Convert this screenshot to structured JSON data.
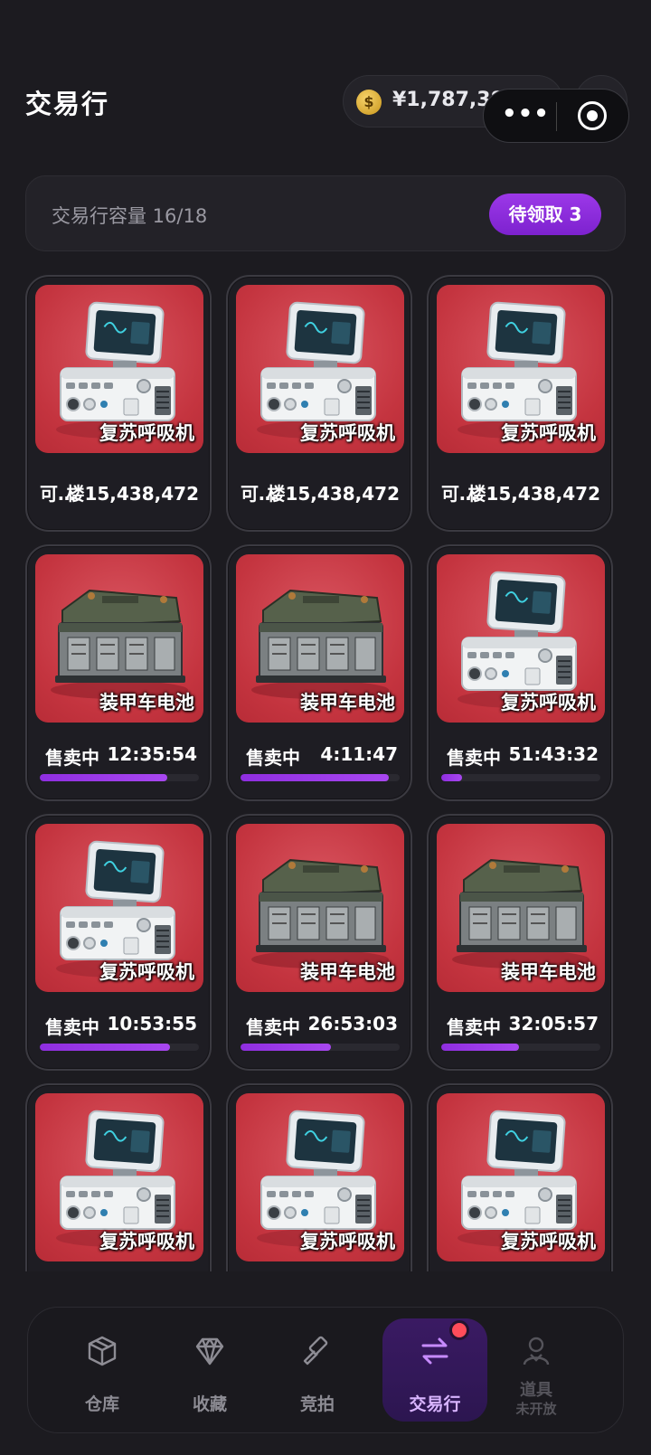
{
  "header": {
    "title": "交易行",
    "coin_symbol": "$",
    "balance": "¥1,787,382,693",
    "plus_label": "+"
  },
  "capacity": {
    "label": "交易行容量 16/18",
    "pending_button": "待领取 3"
  },
  "cards": [
    {
      "item": "复苏呼吸机",
      "icon": "ventilator",
      "mode": "price",
      "price_prefix": "可…",
      "price": "楼15,438,472"
    },
    {
      "item": "复苏呼吸机",
      "icon": "ventilator",
      "mode": "price",
      "price_prefix": "可…",
      "price": "楼15,438,472"
    },
    {
      "item": "复苏呼吸机",
      "icon": "ventilator",
      "mode": "price",
      "price_prefix": "可…",
      "price": "楼15,438,472"
    },
    {
      "item": "装甲车电池",
      "icon": "battery",
      "mode": "selling",
      "status": "售卖中",
      "time": "12:35:54",
      "progress": 0.8
    },
    {
      "item": "装甲车电池",
      "icon": "battery",
      "mode": "selling",
      "status": "售卖中",
      "time": "4:11:47",
      "progress": 0.93
    },
    {
      "item": "复苏呼吸机",
      "icon": "ventilator",
      "mode": "selling",
      "status": "售卖中",
      "time": "51:43:32",
      "progress": 0.13
    },
    {
      "item": "复苏呼吸机",
      "icon": "ventilator",
      "mode": "selling",
      "status": "售卖中",
      "time": "10:53:55",
      "progress": 0.82
    },
    {
      "item": "装甲车电池",
      "icon": "battery",
      "mode": "selling",
      "status": "售卖中",
      "time": "26:53:03",
      "progress": 0.57
    },
    {
      "item": "装甲车电池",
      "icon": "battery",
      "mode": "selling",
      "status": "售卖中",
      "time": "32:05:57",
      "progress": 0.49
    },
    {
      "item": "复苏呼吸机",
      "icon": "ventilator",
      "mode": "selling",
      "status": "",
      "time": "",
      "progress": 0
    },
    {
      "item": "复苏呼吸机",
      "icon": "ventilator",
      "mode": "selling",
      "status": "",
      "time": "",
      "progress": 0
    },
    {
      "item": "复苏呼吸机",
      "icon": "ventilator",
      "mode": "selling",
      "status": "",
      "time": "",
      "progress": 0
    }
  ],
  "tabs": [
    {
      "label": "仓库",
      "icon": "box-icon"
    },
    {
      "label": "收藏",
      "icon": "diamond-icon"
    },
    {
      "label": "竞拍",
      "icon": "gavel-icon"
    },
    {
      "label": "交易行",
      "icon": "swap-icon"
    },
    {
      "label": "道具",
      "sublabel": "未开放",
      "icon": "person-icon"
    }
  ],
  "colors": {
    "accent": "#9b37e6",
    "card_bg": "#c73a45",
    "page_bg": "#1c1b20"
  }
}
